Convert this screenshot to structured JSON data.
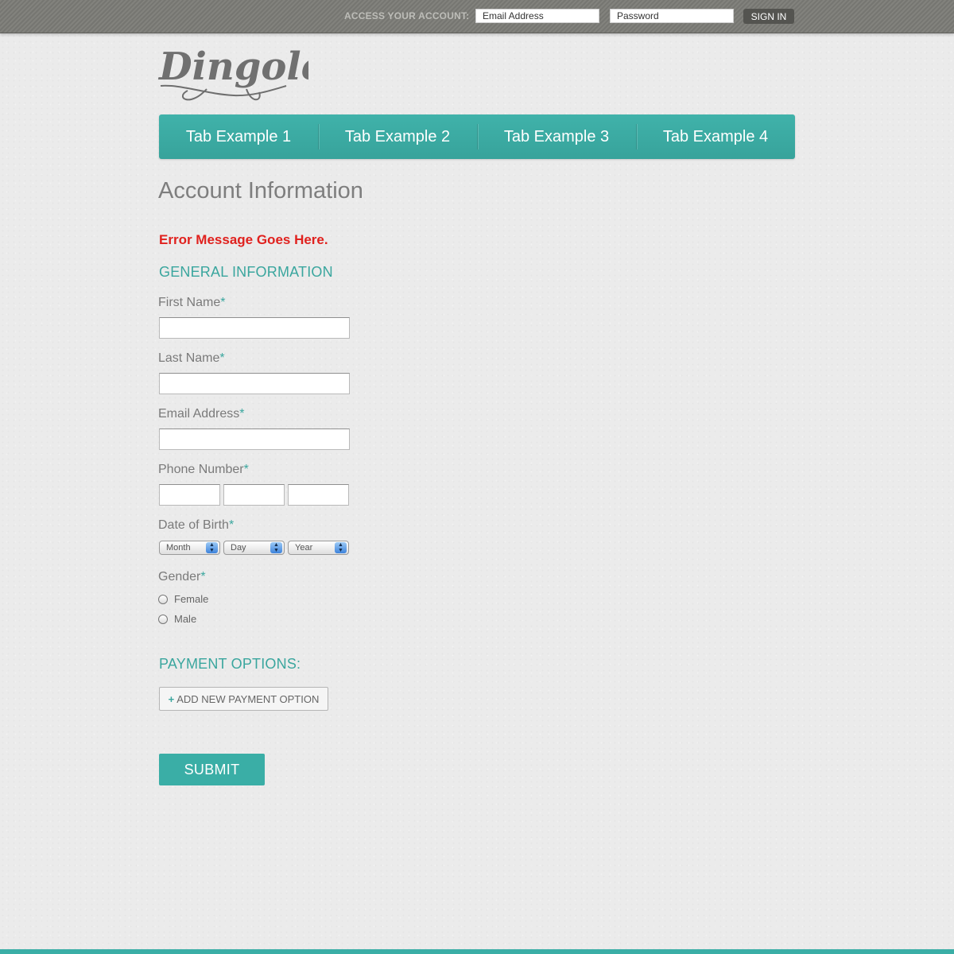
{
  "topbar": {
    "access_label": "ACCESS YOUR ACCOUNT:",
    "email_placeholder": "Email Address",
    "password_placeholder": "Password",
    "sign_in_label": "SIGN IN"
  },
  "logo": {
    "text": "Dingolé"
  },
  "tabs": [
    {
      "label": "Tab Example 1"
    },
    {
      "label": "Tab Example 2"
    },
    {
      "label": "Tab Example 3"
    },
    {
      "label": "Tab Example 4"
    }
  ],
  "page": {
    "title": "Account Information",
    "error_message": "Error Message Goes Here."
  },
  "general": {
    "section_title": "GENERAL INFORMATION",
    "first_name_label": "First Name",
    "last_name_label": "Last Name",
    "email_label": "Email Address",
    "phone_label": "Phone Number",
    "dob_label": "Date of Birth",
    "gender_label": "Gender",
    "required_marker": "*",
    "dob": {
      "month": "Month",
      "day": "Day",
      "year": "Year"
    },
    "gender_options": {
      "female": "Female",
      "male": "Male"
    }
  },
  "payment": {
    "section_title": "PAYMENT OPTIONS:",
    "add_plus": "+",
    "add_label": "ADD NEW PAYMENT OPTION"
  },
  "form": {
    "submit_label": "SUBMIT"
  },
  "colors": {
    "accent": "#3aaea6",
    "error": "#e0211e",
    "topbar": "#7b7b76"
  },
  "icons": {
    "select_arrow": "select-arrow-icon",
    "radio": "radio-circle-icon"
  }
}
